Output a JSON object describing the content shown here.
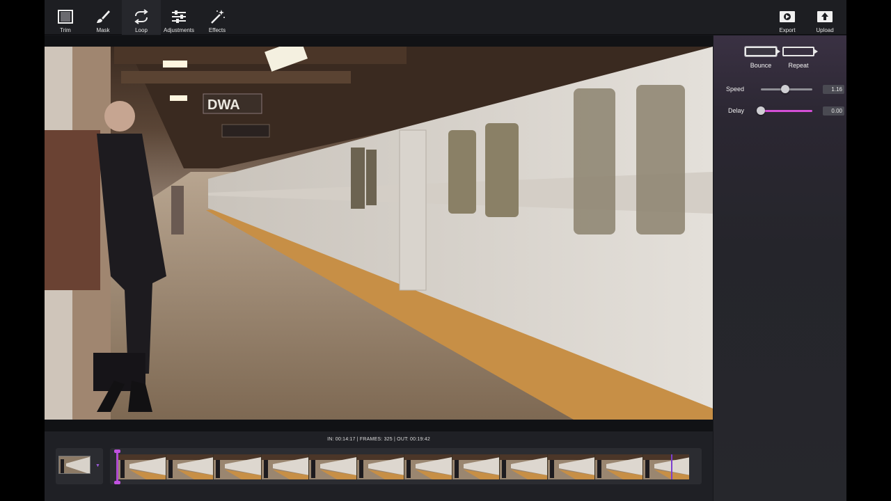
{
  "toolbar": {
    "tools": [
      {
        "label": "Trim",
        "icon": "trim-icon"
      },
      {
        "label": "Mask",
        "icon": "brush-icon"
      },
      {
        "label": "Loop",
        "icon": "loop-icon"
      },
      {
        "label": "Adjustments",
        "icon": "sliders-icon"
      },
      {
        "label": "Effects",
        "icon": "magic-wand-icon"
      }
    ],
    "active_tool": "Loop",
    "export_label": "Export",
    "upload_label": "Upload"
  },
  "video": {
    "sign_text": "DWA"
  },
  "loop_panel": {
    "modes": [
      {
        "label": "Bounce",
        "icon": "bounce-icon",
        "selected": true
      },
      {
        "label": "Repeat",
        "icon": "repeat-icon",
        "selected": false
      }
    ],
    "speed": {
      "label": "Speed",
      "value": "1.16",
      "position": 0.47
    },
    "delay": {
      "label": "Delay",
      "value": "0.00",
      "position": 0.0
    }
  },
  "timeline": {
    "info": "IN: 00:14:17 | FRAMES: 325 | OUT: 00:19:42",
    "frame_count": 12
  },
  "colors": {
    "accent": "#d44fd6",
    "marker": "#b04ad2",
    "playhead": "#7b3fd0"
  }
}
